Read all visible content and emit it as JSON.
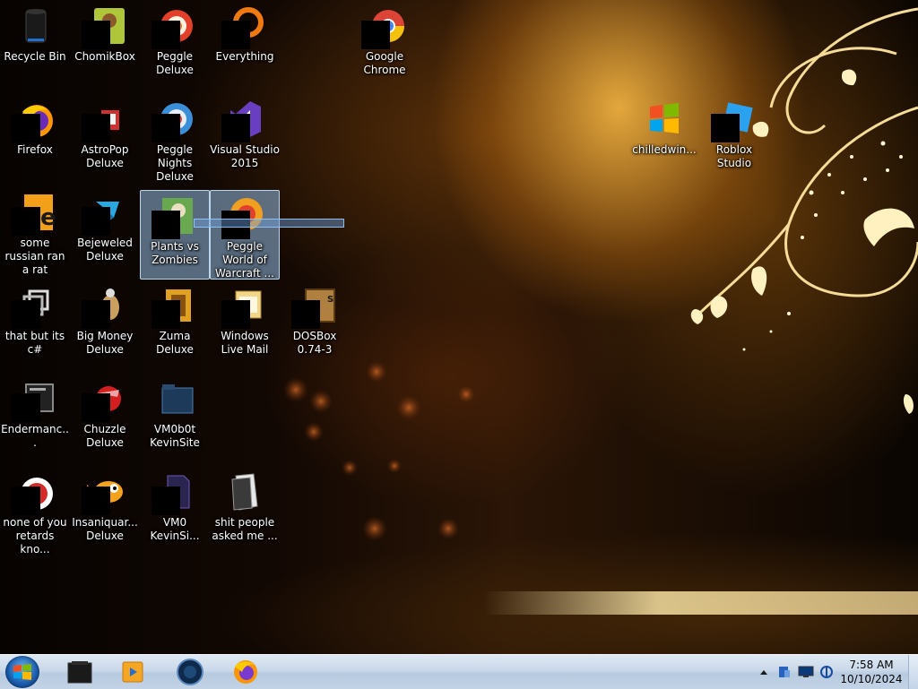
{
  "desktop": {
    "icons": [
      {
        "label": "Recycle Bin",
        "icon": "recycle-bin-icon"
      },
      {
        "label": "ChomikBox",
        "icon": "chomikbox-icon"
      },
      {
        "label": "Peggle Deluxe",
        "icon": "peggle-icon"
      },
      {
        "label": "Everything",
        "icon": "everything-search-icon"
      },
      {
        "label": "Google Chrome",
        "icon": "chrome-icon"
      },
      {
        "label": "Firefox",
        "icon": "firefox-icon"
      },
      {
        "label": "AstroPop Deluxe",
        "icon": "astropop-icon"
      },
      {
        "label": "Peggle Nights Deluxe",
        "icon": "peggle-nights-icon"
      },
      {
        "label": "Visual Studio 2015",
        "icon": "visual-studio-icon"
      },
      {
        "label": "chilledwin...",
        "icon": "windows-flag-icon"
      },
      {
        "label": "Roblox Studio",
        "icon": "roblox-studio-icon"
      },
      {
        "label": "some russian ran a rat",
        "icon": "shortcut-icon"
      },
      {
        "label": "Bejeweled Deluxe",
        "icon": "bejeweled-icon"
      },
      {
        "label": "Plants vs Zombies",
        "icon": "plants-vs-zombies-icon"
      },
      {
        "label": "Peggle World of Warcraft ...",
        "icon": "peggle-wow-icon"
      },
      {
        "label": "that but its c#",
        "icon": "shortcut-icon"
      },
      {
        "label": "Big Money Deluxe",
        "icon": "big-money-icon"
      },
      {
        "label": "Zuma Deluxe",
        "icon": "zuma-icon"
      },
      {
        "label": "Windows Live Mail",
        "icon": "live-mail-icon"
      },
      {
        "label": "DOSBox 0.74-3",
        "icon": "dosbox-icon"
      },
      {
        "label": "Endermanc...",
        "icon": "app-window-icon"
      },
      {
        "label": "Chuzzle Deluxe",
        "icon": "chuzzle-icon"
      },
      {
        "label": "VM0b0t KevinSite",
        "icon": "folder-icon"
      },
      {
        "label": "none of you retards kno...",
        "icon": "shortcut-icon"
      },
      {
        "label": "Insaniquar... Deluxe",
        "icon": "insaniquarium-icon"
      },
      {
        "label": "VM0 KevinSi...",
        "icon": "file-icon"
      },
      {
        "label": "shit people asked me ...",
        "icon": "folder-icon"
      }
    ]
  },
  "taskbar": {
    "start_icon": "windows-orb-icon",
    "pinned": [
      {
        "icon": "window-app-icon"
      },
      {
        "icon": "media-player-icon"
      },
      {
        "icon": "globe-app-icon"
      },
      {
        "icon": "firefox-icon"
      }
    ],
    "tray": {
      "show_hidden_icon": "chevron-up-icon",
      "icons": [
        "network-status-icon",
        "monitor-icon",
        "power-plug-icon"
      ],
      "time": "7:58 AM",
      "date": "10/10/2024"
    }
  },
  "colors": {
    "taskbar": "#c9d8e9",
    "selection": "#96bee6",
    "wallpaper_accent": "#f5c15a"
  }
}
